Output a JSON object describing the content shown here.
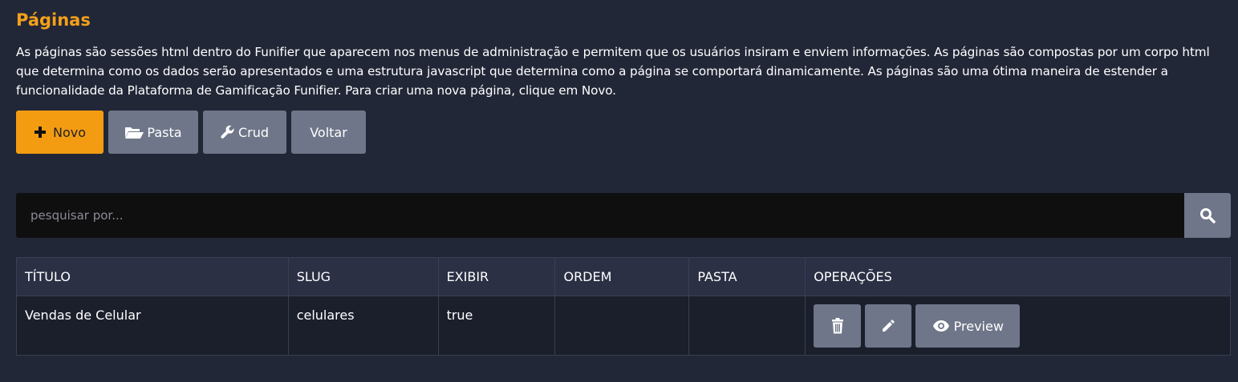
{
  "page": {
    "title": "Páginas",
    "description": "As páginas são sessões html dentro do Funifier que aparecem nos menus de administração e permitem que os usuários insiram e enviem informações. As páginas são compostas por um corpo html que determina como os dados serão apresentados e uma estrutura javascript que determina como a página se comportará dinamicamente. As páginas são uma ótima maneira de estender a funcionalidade da Plataforma de Gamificação Funifier. Para criar uma nova página, clique em Novo."
  },
  "toolbar": {
    "new_label": "Novo",
    "folder_label": "Pasta",
    "crud_label": "Crud",
    "back_label": "Voltar"
  },
  "search": {
    "placeholder": "pesquisar por..."
  },
  "table": {
    "headers": [
      "TÍTULO",
      "SLUG",
      "EXIBIR",
      "ORDEM",
      "PASTA",
      "OPERAÇÕES"
    ],
    "rows": [
      {
        "title": "Vendas de Celular",
        "slug": "celulares",
        "show": "true",
        "order": "",
        "folder": ""
      }
    ],
    "preview_label": "Preview"
  },
  "colors": {
    "accent": "#f39c12",
    "background": "#222737",
    "button": "#6f7689"
  },
  "icons": [
    "plus-icon",
    "folder-open-icon",
    "wrench-icon",
    "search-icon",
    "trash-icon",
    "pencil-icon",
    "eye-icon"
  ]
}
